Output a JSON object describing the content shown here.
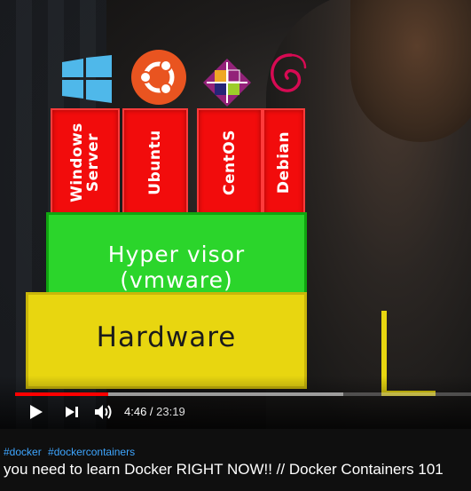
{
  "video": {
    "os_blocks": [
      {
        "label": "Windows\nServer"
      },
      {
        "label": "Ubuntu"
      },
      {
        "label": "CentOS"
      },
      {
        "label": "Debian"
      }
    ],
    "hypervisor_label": "Hyper visor (vmware)",
    "hardware_label": "Hardware",
    "logos": [
      "windows-icon",
      "ubuntu-icon",
      "centos-icon",
      "debian-icon"
    ]
  },
  "player": {
    "current_time": "4:46",
    "separator": " / ",
    "duration": "23:19",
    "progress_fraction": 0.2045,
    "buffered_fraction": 0.72,
    "accent": "#ff0000"
  },
  "hashtags": [
    "#docker",
    "#dockercontainers"
  ],
  "title": "you need to learn Docker RIGHT NOW!! // Docker Containers 101"
}
